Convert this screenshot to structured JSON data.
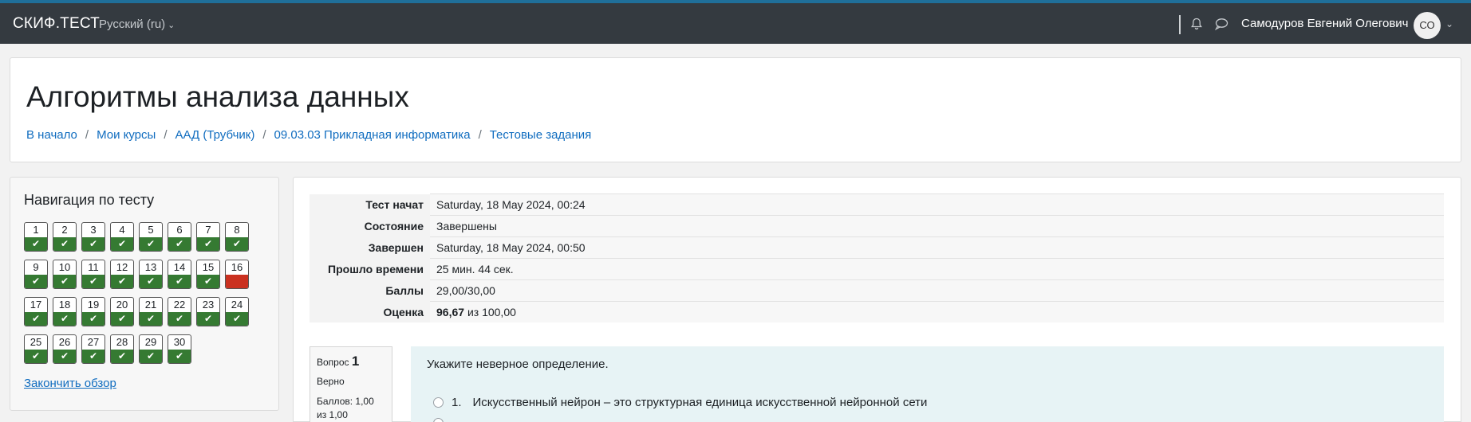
{
  "navbar": {
    "brand": "СКИФ.ТЕСТ",
    "language": "Русский (ru)",
    "user_name": "Самодуров Евгений Олегович",
    "avatar_initials": "СО",
    "icons": [
      "bell-icon",
      "chat-icon",
      "chevron-down-icon"
    ]
  },
  "header": {
    "title": "Алгоритмы анализа данных",
    "breadcrumb": [
      "В начало",
      "Мои курсы",
      "ААД (Трубчик)",
      "09.03.03 Прикладная информатика",
      "Тестовые задания"
    ]
  },
  "quiz_nav": {
    "title": "Навигация по тесту",
    "questions": [
      {
        "n": "1",
        "status": "correct"
      },
      {
        "n": "2",
        "status": "correct"
      },
      {
        "n": "3",
        "status": "correct"
      },
      {
        "n": "4",
        "status": "correct"
      },
      {
        "n": "5",
        "status": "correct"
      },
      {
        "n": "6",
        "status": "correct"
      },
      {
        "n": "7",
        "status": "correct"
      },
      {
        "n": "8",
        "status": "correct"
      },
      {
        "n": "9",
        "status": "correct"
      },
      {
        "n": "10",
        "status": "correct"
      },
      {
        "n": "11",
        "status": "correct"
      },
      {
        "n": "12",
        "status": "correct"
      },
      {
        "n": "13",
        "status": "correct"
      },
      {
        "n": "14",
        "status": "correct"
      },
      {
        "n": "15",
        "status": "correct"
      },
      {
        "n": "16",
        "status": "incorrect"
      },
      {
        "n": "17",
        "status": "correct"
      },
      {
        "n": "18",
        "status": "correct"
      },
      {
        "n": "19",
        "status": "correct"
      },
      {
        "n": "20",
        "status": "correct"
      },
      {
        "n": "21",
        "status": "correct"
      },
      {
        "n": "22",
        "status": "correct"
      },
      {
        "n": "23",
        "status": "correct"
      },
      {
        "n": "24",
        "status": "correct"
      },
      {
        "n": "25",
        "status": "correct"
      },
      {
        "n": "26",
        "status": "correct"
      },
      {
        "n": "27",
        "status": "correct"
      },
      {
        "n": "28",
        "status": "correct"
      },
      {
        "n": "29",
        "status": "correct"
      },
      {
        "n": "30",
        "status": "correct"
      }
    ],
    "finish_link": "Закончить обзор"
  },
  "summary": {
    "rows": [
      {
        "label": "Тест начат",
        "value": "Saturday, 18 May 2024, 00:24"
      },
      {
        "label": "Состояние",
        "value": "Завершены"
      },
      {
        "label": "Завершен",
        "value": "Saturday, 18 May 2024, 00:50"
      },
      {
        "label": "Прошло времени",
        "value": "25 мин. 44 сек."
      },
      {
        "label": "Баллы",
        "value": "29,00/30,00"
      }
    ],
    "grade_label": "Оценка",
    "grade_value": "96,67",
    "grade_suffix": "из 100,00"
  },
  "question": {
    "label": "Вопрос",
    "number": "1",
    "state": "Верно",
    "marks": "Баллов: 1,00 из 1,00",
    "text": "Укажите неверное определение.",
    "options": [
      {
        "n": "1.",
        "text": "Искусственный нейрон – это структурная единица искусственной нейронной сети"
      }
    ]
  },
  "colors": {
    "navbar": "#343a40",
    "link": "#0f6cbf",
    "correct": "#357a32",
    "incorrect": "#ca3120",
    "question_bg": "#e7f3f5"
  }
}
